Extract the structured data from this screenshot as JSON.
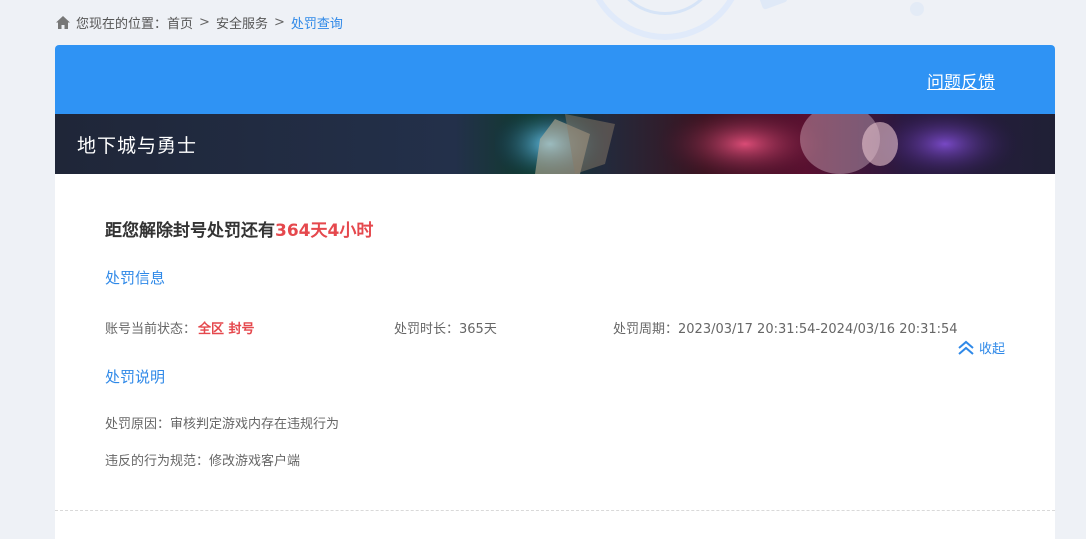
{
  "breadcrumb": {
    "prefix": "您现在的位置：",
    "items": [
      "首页",
      "安全服务",
      "处罚查询"
    ],
    "separator": ">"
  },
  "header": {
    "feedback_label": "问题反馈",
    "accent_color": "#2f93f4"
  },
  "banner": {
    "game_title": "地下城与勇士"
  },
  "punishment": {
    "countdown_prefix": "距您解除封号处罚还有",
    "countdown_remaining": "364天4小时",
    "info_section_title": "处罚信息",
    "status_label": "账号当前状态：",
    "status_value": "全区 封号",
    "duration": "处罚时长：365天",
    "period": "处罚周期：2023/03/17 20:31:54-2024/03/16 20:31:54",
    "desc_section_title": "处罚说明",
    "reason": "处罚原因：审核判定游戏内存在违规行为",
    "violation": "违反的行为规范：修改游戏客户端",
    "collapse_label": "收起",
    "highlight_color": "#e5484d"
  },
  "icons": {
    "home": "home-icon",
    "collapse": "double-chevron-up-icon"
  }
}
